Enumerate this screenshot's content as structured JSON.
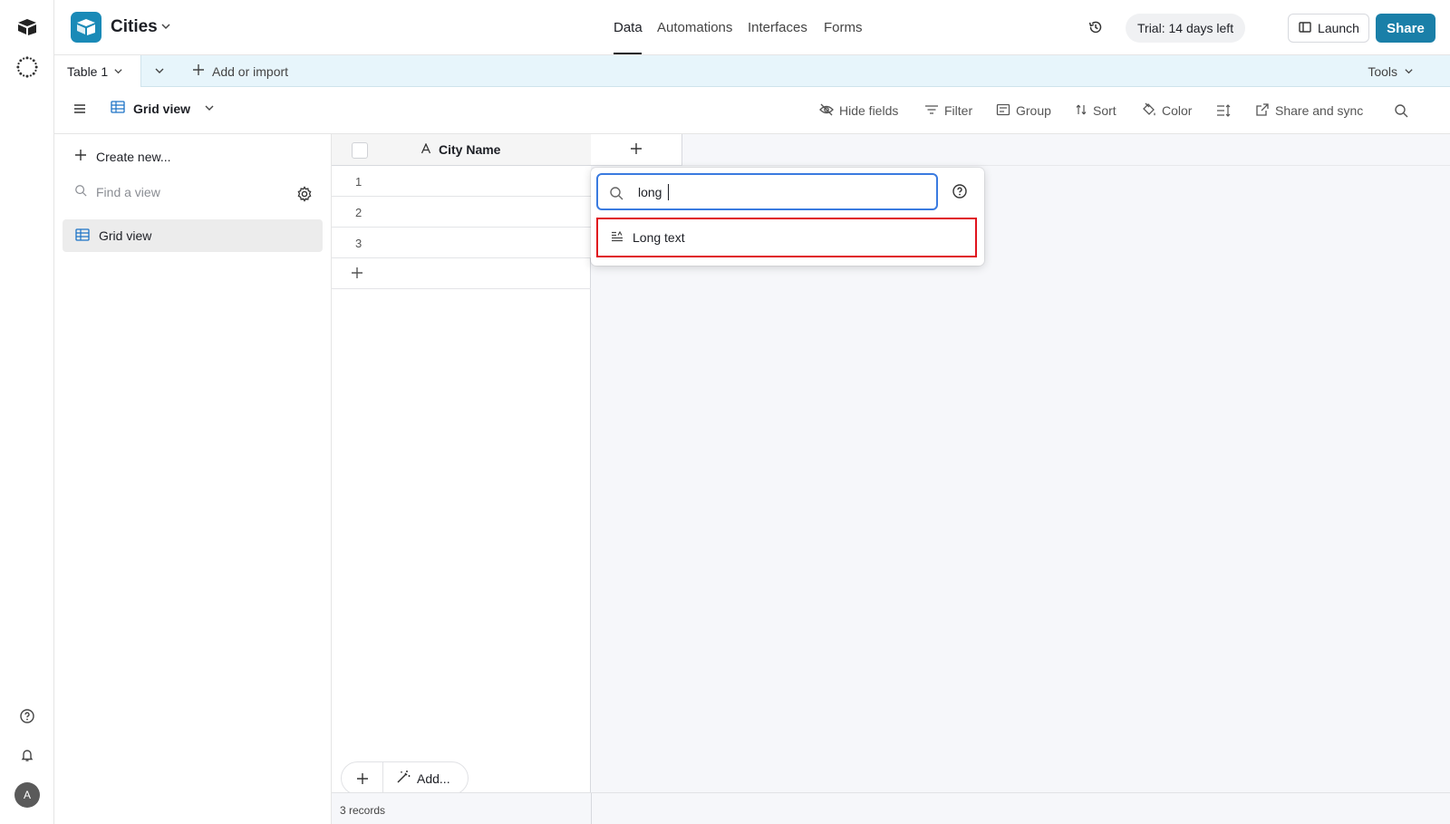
{
  "base": {
    "name": "Cities"
  },
  "nav": {
    "tabs": [
      "Data",
      "Automations",
      "Interfaces",
      "Forms"
    ]
  },
  "header": {
    "trial": "Trial: 14 days left",
    "launch": "Launch",
    "share": "Share"
  },
  "tables": {
    "active": "Table 1",
    "add_import": "Add or import",
    "tools": "Tools"
  },
  "viewbar": {
    "view_name": "Grid view",
    "hide_fields": "Hide fields",
    "filter": "Filter",
    "group": "Group",
    "sort": "Sort",
    "color": "Color",
    "share_sync": "Share and sync"
  },
  "sidebar": {
    "create_new": "Create new...",
    "find_placeholder": "Find a view",
    "views": [
      {
        "label": "Grid view"
      }
    ]
  },
  "grid": {
    "columns": [
      {
        "label": "City Name"
      }
    ],
    "rows": [
      {
        "number": "1"
      },
      {
        "number": "2"
      },
      {
        "number": "3"
      }
    ],
    "record_count": "3 records",
    "add_label": "Add..."
  },
  "field_popup": {
    "search_value": "long",
    "options": [
      {
        "label": "Long text"
      }
    ]
  },
  "avatar": {
    "initial": "A"
  },
  "colors": {
    "accent": "#1a7fa8",
    "tab_bar": "#e7f5fb",
    "highlight_border": "#e0141e",
    "focus_border": "#3a7be0"
  },
  "icons": [
    "airtable-logo-icon",
    "omni-icon",
    "base-logo-icon",
    "history-icon",
    "launch-icon",
    "hamburger-icon",
    "grid-icon",
    "eye-off-icon",
    "filter-icon",
    "group-icon",
    "sort-icon",
    "color-icon",
    "row-height-icon",
    "share-sync-icon",
    "search-icon",
    "plus-icon",
    "gear-icon",
    "text-field-icon",
    "help-icon",
    "long-text-icon",
    "bell-icon",
    "magic-wand-icon",
    "chevron-down-icon"
  ]
}
